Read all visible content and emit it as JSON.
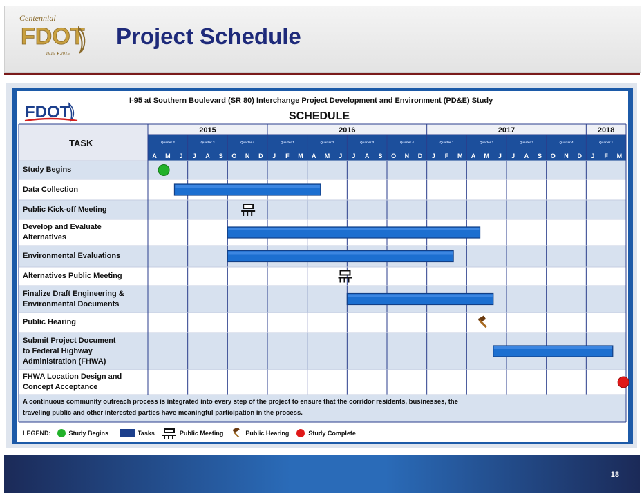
{
  "slide": {
    "title": "Project Schedule",
    "page_number": "18",
    "logo": {
      "top_text": "Centennial",
      "main_text": "FDOT",
      "years": "1915 ♦ 2015"
    }
  },
  "schedule": {
    "logo_text": "FDOT",
    "study_title": "I-95 at Southern Boulevard (SR 80) Interchange Project Development and Environment (PD&E) Study",
    "heading": "SCHEDULE",
    "task_header": "TASK",
    "years": [
      {
        "label": "2015",
        "span": 3
      },
      {
        "label": "2016",
        "span": 4
      },
      {
        "label": "2017",
        "span": 4
      },
      {
        "label": "2018",
        "span": 1
      }
    ],
    "quarters": [
      "Quarter 2",
      "Quarter 3",
      "Quarter 4",
      "Quarter 1",
      "Quarter 2",
      "Quarter 3",
      "Quarter 4",
      "Quarter 1",
      "Quarter 2",
      "Quarter 3",
      "Quarter 4",
      "Quarter 1"
    ],
    "months": [
      "A",
      "M",
      "J",
      "J",
      "A",
      "S",
      "O",
      "N",
      "D",
      "J",
      "F",
      "M",
      "A",
      "M",
      "J",
      "J",
      "A",
      "S",
      "O",
      "N",
      "D",
      "J",
      "F",
      "M",
      "A",
      "M",
      "J",
      "J",
      "A",
      "S",
      "O",
      "N",
      "D",
      "J",
      "F",
      "M"
    ],
    "tasks": [
      {
        "lines": [
          "Study Begins"
        ],
        "marker": {
          "type": "study-begins",
          "month": 1.2
        }
      },
      {
        "lines": [
          "Data Collection"
        ],
        "bar": {
          "start": 2.0,
          "end": 13.0
        }
      },
      {
        "lines": [
          "Public Kick-off Meeting"
        ],
        "marker": {
          "type": "public-meeting",
          "month": 7.5
        }
      },
      {
        "lines": [
          "Develop and Evaluate",
          "Alternatives"
        ],
        "bar": {
          "start": 6.0,
          "end": 25.0
        }
      },
      {
        "lines": [
          "Environmental Evaluations"
        ],
        "bar": {
          "start": 6.0,
          "end": 23.0
        }
      },
      {
        "lines": [
          "Alternatives Public Meeting"
        ],
        "marker": {
          "type": "public-meeting",
          "month": 14.8
        }
      },
      {
        "lines": [
          "Finalize Draft Engineering &",
          "Environmental Documents"
        ],
        "bar": {
          "start": 15.0,
          "end": 26.0
        }
      },
      {
        "lines": [
          "Public Hearing"
        ],
        "marker": {
          "type": "public-hearing",
          "month": 25.2
        }
      },
      {
        "lines": [
          "Submit Project Document",
          "to Federal Highway",
          "Administration (FHWA)"
        ],
        "bar": {
          "start": 26.0,
          "end": 35.0
        }
      },
      {
        "lines": [
          "FHWA Location Design and",
          "Concept Acceptance"
        ],
        "marker": {
          "type": "study-complete",
          "month": 35.8
        }
      }
    ],
    "note_lines": [
      "A continuous community outreach process is integrated into every step of the project to ensure that the corridor residents, businesses, the",
      "traveling public and other interested parties have meaningful participation in the process."
    ],
    "legend": {
      "title": "LEGEND:",
      "items": [
        {
          "label": "Study Begins",
          "icon": "green-circle-icon"
        },
        {
          "label": "Tasks",
          "icon": "task-bar-icon"
        },
        {
          "label": "Public Meeting",
          "icon": "public-meeting-icon"
        },
        {
          "label": "Public Hearing",
          "icon": "gavel-icon"
        },
        {
          "label": "Study Complete",
          "icon": "red-circle-icon"
        }
      ]
    },
    "colors": {
      "bar": "#1c6fd0",
      "row_band": "#d7e1ef",
      "header_fill": "#1c4f9c",
      "green": "#22b22a",
      "red": "#e01818",
      "grid_line": "#2b3e8c"
    }
  }
}
